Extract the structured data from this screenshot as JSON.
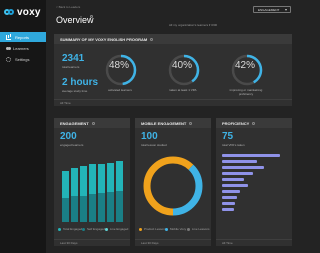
{
  "logo": {
    "text": "voxy"
  },
  "sidebar": {
    "items": [
      {
        "label": "Reports",
        "icon": "report-icon",
        "active": true
      },
      {
        "label": "Learners",
        "icon": "learners-icon",
        "active": false
      },
      {
        "label": "Settings",
        "icon": "gear-icon",
        "active": false
      }
    ]
  },
  "header": {
    "breadcrumb": "< Back to Leaders",
    "title": "Overview",
    "org_label": "All my organization's learners  ▾ 0/00",
    "org_select": "ENGAGEMENT"
  },
  "summary": {
    "title": "SUMMARY OF MY VOXY ENGLISH PROGRAM",
    "stats": [
      {
        "value": "2341",
        "label": "total learners"
      },
      {
        "value": "2 hours",
        "label": "average study time"
      }
    ],
    "rings": [
      {
        "pct": "48%",
        "fraction": 0.48,
        "label": "activated learners"
      },
      {
        "pct": "40%",
        "fraction": 0.4,
        "label": "taken at least 1 VPA"
      },
      {
        "pct": "42%",
        "fraction": 0.42,
        "label": "improving or maintaining proficiency"
      }
    ],
    "footer": "All Time"
  },
  "engagement": {
    "title": "ENGAGEMENT",
    "value": "200",
    "label": "engaged learners",
    "legend": [
      "Total Engaged",
      "Self Engaged",
      "Live Engaged"
    ],
    "footer": "Last 30 Days"
  },
  "mobile": {
    "title": "MOBILE ENGAGEMENT",
    "value": "100",
    "label": "total lesson studied",
    "legend": [
      "Product Lessons",
      "Mobile Voxy",
      "Live Lessons"
    ],
    "footer": "Last 30 Days"
  },
  "proficiency": {
    "title": "PROFICIENCY",
    "value": "75",
    "label": "total VPA's taken",
    "footer": "All Time"
  },
  "colors": {
    "accent": "#3fb3e6",
    "teal": "#23b4b8",
    "orange": "#f0a21c",
    "ring_track": "#4a4a4a",
    "purple": "#8f92e8"
  },
  "chart_data": [
    {
      "type": "bar",
      "title": "ENGAGEMENT",
      "categories": [
        "1",
        "2",
        "3",
        "4",
        "5",
        "6",
        "7"
      ],
      "series": [
        {
          "name": "Total Engaged",
          "values": [
            58,
            62,
            64,
            66,
            66,
            68,
            70
          ]
        },
        {
          "name": "Self Engaged",
          "values": [
            28,
            30,
            30,
            32,
            33,
            34,
            35
          ]
        }
      ]
    },
    {
      "type": "pie",
      "title": "MOBILE ENGAGEMENT",
      "categories": [
        "Product Lessons",
        "Mobile Voxy"
      ],
      "values": [
        62,
        38
      ]
    },
    {
      "type": "bar",
      "title": "PROFICIENCY",
      "categories": [
        "1",
        "2",
        "3",
        "4",
        "5",
        "6",
        "7",
        "8",
        "9",
        "10"
      ],
      "values": [
        90,
        55,
        65,
        48,
        35,
        40,
        28,
        24,
        20,
        18
      ]
    }
  ]
}
